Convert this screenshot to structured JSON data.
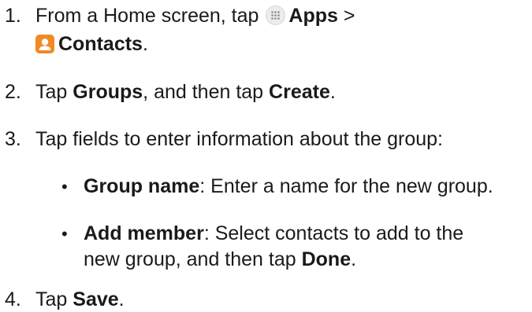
{
  "steps": [
    {
      "num": "1.",
      "text_before": "From a Home screen, tap ",
      "apps_icon": "apps-grid-icon",
      "apps_label": "Apps",
      "sep": " >",
      "contacts_icon": "contacts-person-icon",
      "contacts_label": "Contacts",
      "end": "."
    },
    {
      "num": "2.",
      "t1": "Tap ",
      "b1": "Groups",
      "t2": ", and then tap ",
      "b2": "Create",
      "t3": "."
    },
    {
      "num": "3.",
      "text": "Tap fields to enter information about the group:"
    },
    {
      "num": "4.",
      "t1": "Tap ",
      "b1": "Save",
      "t2": "."
    }
  ],
  "bullets": [
    {
      "dot": "•",
      "label": "Group name",
      "text": ": Enter a name for the new group."
    },
    {
      "dot": "•",
      "label": "Add member",
      "text": ": Select contacts to add to the",
      "line2_text": "new group, and then tap ",
      "line2_bold": "Done",
      "line2_end": "."
    }
  ],
  "colors": {
    "text": "#1a1a1a",
    "contacts_icon": "#f08a24",
    "apps_icon_bg": "#ececef"
  }
}
